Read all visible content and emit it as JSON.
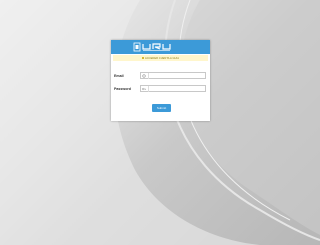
{
  "header": {
    "logo_icon": "uru-logo"
  },
  "notice": {
    "text": "ACCEDER CUENTA A GUIA"
  },
  "form": {
    "email_label": "Email",
    "email_icon": "at-icon",
    "email_value": "",
    "password_label": "Password",
    "password_icon": "key-icon",
    "password_value": "",
    "submit_label": "Submit"
  },
  "colors": {
    "accent": "#3c9ad8",
    "notice_bg": "#fff6cc",
    "card_bg": "#ffffff"
  }
}
